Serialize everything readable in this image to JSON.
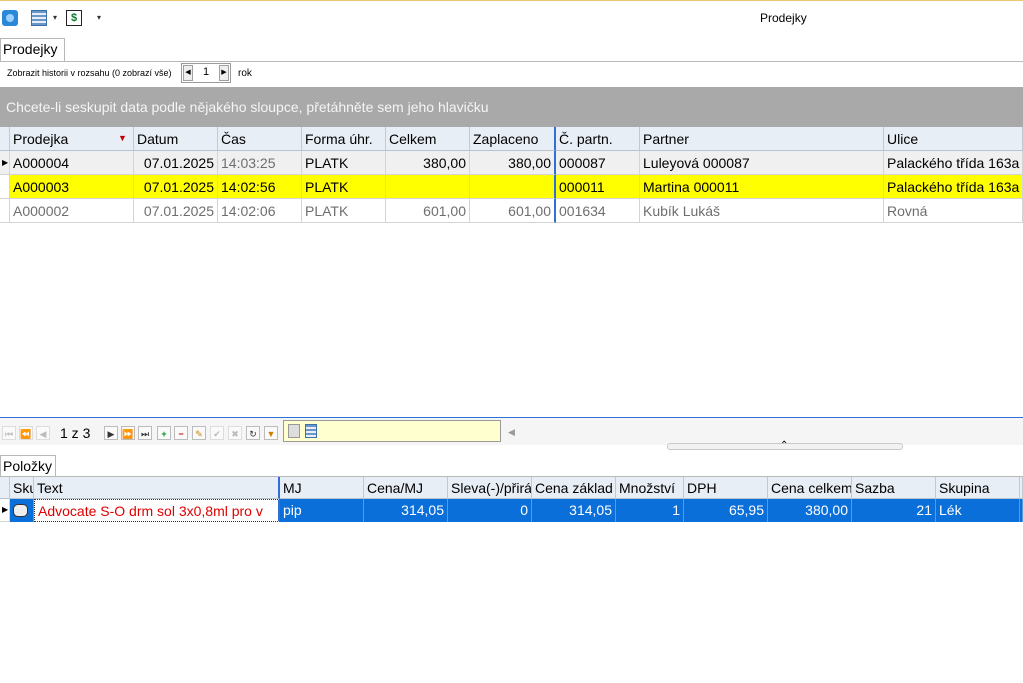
{
  "window": {
    "title": "Prodejky"
  },
  "quick_access": {
    "icons": [
      "app-icon",
      "list-icon",
      "dollar-icon"
    ],
    "caret": "▾"
  },
  "tabs": {
    "main": "Prodejky",
    "items": "Položky"
  },
  "history": {
    "label": "Zobrazit historii v rozsahu (0 zobrazí vše)",
    "value": "1",
    "unit": "rok"
  },
  "group_panel": {
    "text": "Chcete-li seskupit data podle nějakého sloupce, přetáhněte sem jeho hlavičku"
  },
  "sales_grid": {
    "columns": [
      "Prodejka",
      "Datum",
      "Čas",
      "Forma úhr.",
      "Celkem",
      "Zaplaceno",
      "Č. partn.",
      "Partner",
      "Ulice"
    ],
    "sorted_column": "Prodejka",
    "rows": [
      {
        "prodejka": "A000004",
        "datum": "07.01.2025",
        "cas": "14:03:25",
        "forma": "PLATK",
        "celkem": "380,00",
        "zaplaceno": "380,00",
        "cpartn": "000087",
        "partner": "Luleyová 000087",
        "ulice": "Palackého třída 163a"
      },
      {
        "prodejka": "A000003",
        "datum": "07.01.2025",
        "cas": "14:02:56",
        "forma": "PLATK",
        "celkem": "",
        "zaplaceno": "",
        "cpartn": "000011",
        "partner": "Martina 000011",
        "ulice": "Palackého třída 163a"
      },
      {
        "prodejka": "A000002",
        "datum": "07.01.2025",
        "cas": "14:02:06",
        "forma": "PLATK",
        "celkem": "601,00",
        "zaplaceno": "601,00",
        "cpartn": "001634",
        "partner": "Kubík Lukáš",
        "ulice": "Rovná"
      }
    ]
  },
  "navigator": {
    "position": "1 z 3"
  },
  "items_grid": {
    "columns": [
      "Sku",
      "Text",
      "MJ",
      "Cena/MJ",
      "Sleva(-)/přirá",
      "Cena základ",
      "Množství",
      "DPH",
      "Cena celkem",
      "Sazba",
      "Skupina"
    ],
    "rows": [
      {
        "text": "Advocate S-O drm sol 3x0,8ml pro v",
        "mj": "pip",
        "cena_mj": "314,05",
        "sleva": "0",
        "cena_zaklad": "314,05",
        "mnozstvi": "1",
        "dph": "65,95",
        "cena_celkem": "380,00",
        "sazba": "21",
        "skupina": "Lék"
      }
    ]
  }
}
